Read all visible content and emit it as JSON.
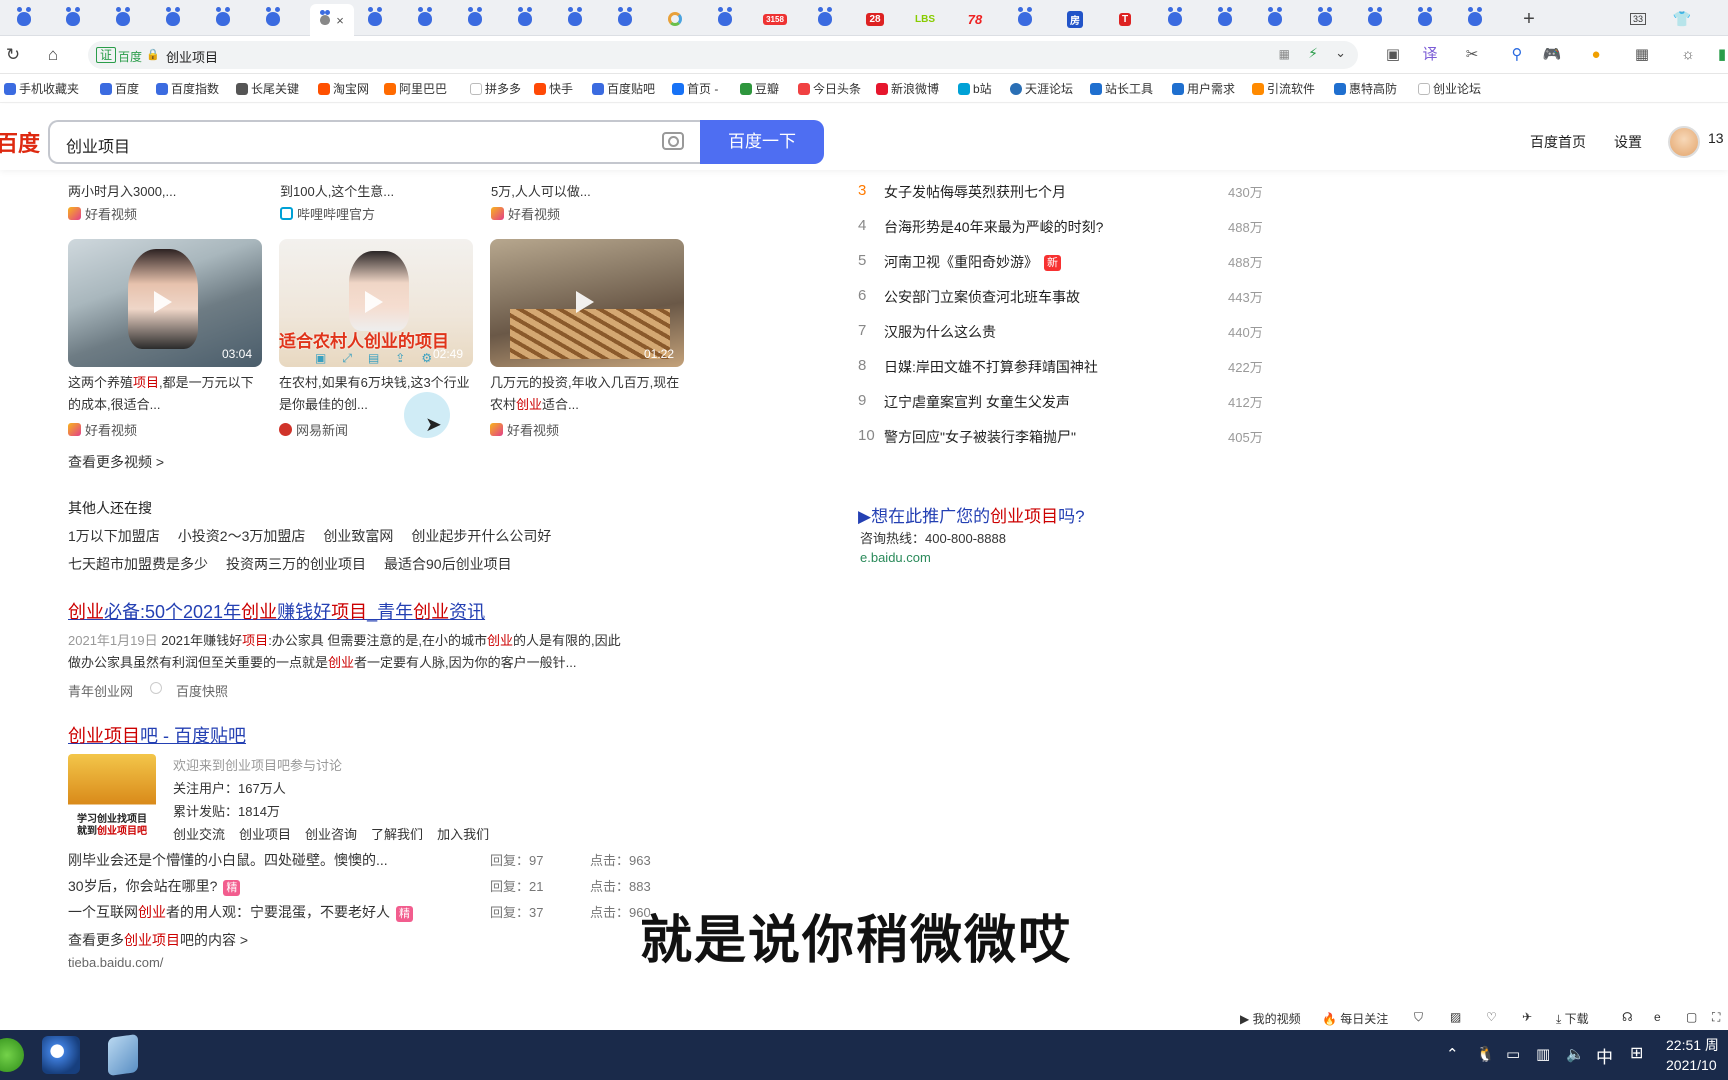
{
  "tabs": {
    "active_close": "×",
    "items": [
      "",
      "",
      "",
      "",
      "",
      "",
      "",
      "",
      "",
      "",
      "",
      "",
      "",
      "",
      "",
      "",
      "",
      "",
      "",
      "",
      "",
      "",
      "",
      "",
      "",
      "",
      "",
      "",
      "",
      "",
      "",
      ""
    ],
    "badge_count": "33",
    "new_tab": "+"
  },
  "addressbar": {
    "secure_label": "证",
    "site_label": "百度",
    "url_text": "创业项目"
  },
  "bookmarks": [
    {
      "label": "手机收藏夹",
      "color": "#3b6be0"
    },
    {
      "label": "百度",
      "color": "#3b6be0"
    },
    {
      "label": "百度指数",
      "color": "#3b6be0"
    },
    {
      "label": "长尾关键",
      "color": "#555555"
    },
    {
      "label": "淘宝网",
      "color": "#ff5000"
    },
    {
      "label": "阿里巴巴",
      "color": "#ff6a00"
    },
    {
      "label": "拼多多",
      "color": "#cccccc"
    },
    {
      "label": "快手",
      "color": "#ff4906"
    },
    {
      "label": "百度贴吧",
      "color": "#3b6be0"
    },
    {
      "label": "首页 -",
      "color": "#1772f6"
    },
    {
      "label": "豆瓣",
      "color": "#2e963d"
    },
    {
      "label": "今日头条",
      "color": "#f04142"
    },
    {
      "label": "新浪微博",
      "color": "#e6162d"
    },
    {
      "label": "b站",
      "color": "#00a1d6"
    },
    {
      "label": "天涯论坛",
      "color": "#2a6fb5"
    },
    {
      "label": "站长工具",
      "color": "#1f6fcf"
    },
    {
      "label": "用户需求",
      "color": "#1f6fcf"
    },
    {
      "label": "引流软件",
      "color": "#ff8a00"
    },
    {
      "label": "惠特高防",
      "color": "#1f6fcf"
    },
    {
      "label": "创业论坛",
      "color": "#cccccc"
    }
  ],
  "search": {
    "logo": "百度",
    "query": "创业项目",
    "button": "百度一下",
    "home_link": "百度首页",
    "settings_link": "设置",
    "user_number": "13"
  },
  "videos_top_row": [
    {
      "desc": "两小时月入3000,...",
      "source": "好看视频"
    },
    {
      "desc": "到100人,这个生意...",
      "source": "哔哩哔哩官方"
    },
    {
      "desc": "5万,人人可以做...",
      "source": "好看视频"
    }
  ],
  "videos": [
    {
      "duration": "03:04",
      "desc_a": "这两个养殖",
      "desc_hl": "项目",
      "desc_b": ",都是一万元以下的成本,很适合...",
      "source": "好看视频"
    },
    {
      "duration": "02:49",
      "overlay_text": "适合农村人创业的项目",
      "desc_a": "在农村,如果有6万块钱,这3个行业是你最佳的创...",
      "desc_hl": "",
      "desc_b": "",
      "source": "网易新闻"
    },
    {
      "duration": "01:22",
      "desc_a": "几万元的投资,年收入几百万,现在农村",
      "desc_hl": "创业",
      "desc_b": "适合...",
      "source": "好看视频"
    }
  ],
  "more_videos": "查看更多视频 >",
  "related": {
    "title": "其他人还在搜",
    "row1": [
      "1万以下加盟店",
      "小投资2～3万加盟店",
      "创业致富网",
      "创业起步开什么公司好"
    ],
    "row2": [
      "七天超市加盟费是多少",
      "投资两三万的创业项目",
      "最适合90后创业项目"
    ]
  },
  "result1": {
    "title_parts": [
      "创业",
      "必备:50个2021年",
      "创业",
      "赚钱好",
      "项目",
      "_青年",
      "创业",
      "资讯"
    ],
    "date": "2021年1月19日",
    "snippet_a": "2021年赚钱好",
    "snippet_hl1": "项目",
    "snippet_b": ":办公家具 但需要注意的是,在小的城市",
    "snippet_hl2": "创业",
    "snippet_c": "的人是有限的,因此",
    "snippet_d": "做办公家具虽然有利润但至关重要的一点就是",
    "snippet_hl3": "创业",
    "snippet_e": "者一定要有人脉,因为你的客户一般针...",
    "source": "青年创业网",
    "cache": "百度快照"
  },
  "result2": {
    "title_hl": "创业项目",
    "title_rest": "吧 - 百度贴吧",
    "welcome": "欢迎来到创业项目吧参与讨论",
    "followers": "关注用户：167万人",
    "posts": "累计发贴：1814万",
    "thumb_line1": "学习创业找项目",
    "thumb_line2a": "就到",
    "thumb_line2b": "创业项目吧",
    "links": [
      "创业交流",
      "创业项目",
      "创业咨询",
      "了解我们",
      "加入我们"
    ],
    "threads": [
      {
        "title_a": "刚毕业会还是个懵懂的小白鼠。四处碰壁。懊懊的...",
        "hl": "",
        "title_b": "",
        "tag": "",
        "replies": "回复：97",
        "clicks": "点击：963"
      },
      {
        "title_a": "30岁后，你会站在哪里?",
        "hl": "",
        "title_b": "",
        "tag": "精",
        "replies": "回复：21",
        "clicks": "点击：883"
      },
      {
        "title_a": "一个互联网",
        "hl": "创业",
        "title_b": "者的用人观：宁要混蛋，不要老好人",
        "tag": "精",
        "replies": "回复：37",
        "clicks": "点击：960"
      }
    ],
    "more_a": "查看更多",
    "more_hl": "创业项目",
    "more_b": "吧的内容 >",
    "domain": "tieba.baidu.com/"
  },
  "hot_list": [
    {
      "rank": "3",
      "title": "女子发帖侮辱英烈获刑七个月",
      "value": "430万",
      "tag": ""
    },
    {
      "rank": "4",
      "title": "台海形势是40年来最为严峻的时刻?",
      "value": "488万",
      "tag": ""
    },
    {
      "rank": "5",
      "title": "河南卫视《重阳奇妙游》",
      "value": "488万",
      "tag": "新"
    },
    {
      "rank": "6",
      "title": "公安部门立案侦查河北班车事故",
      "value": "443万",
      "tag": ""
    },
    {
      "rank": "7",
      "title": "汉服为什么这么贵",
      "value": "440万",
      "tag": ""
    },
    {
      "rank": "8",
      "title": "日媒:岸田文雄不打算参拜靖国神社",
      "value": "422万",
      "tag": ""
    },
    {
      "rank": "9",
      "title": "辽宁虐童案宣判 女童生父发声",
      "value": "412万",
      "tag": ""
    },
    {
      "rank": "10",
      "title": "警方回应\"女子被装行李箱抛尸\"",
      "value": "405万",
      "tag": ""
    }
  ],
  "ad": {
    "title_a": "▶想在此推广您的",
    "title_hl": "创业项目",
    "title_b": "吗?",
    "hotline": "咨询热线：400-800-8888",
    "domain": "e.baidu.com"
  },
  "caption": "就是说你稍微微哎",
  "statusbar": {
    "my_video": "我的视频",
    "daily": "每日关注",
    "download": "下载"
  },
  "taskbar": {
    "ime": "中",
    "time": "22:51 周",
    "date": "2021/10"
  }
}
